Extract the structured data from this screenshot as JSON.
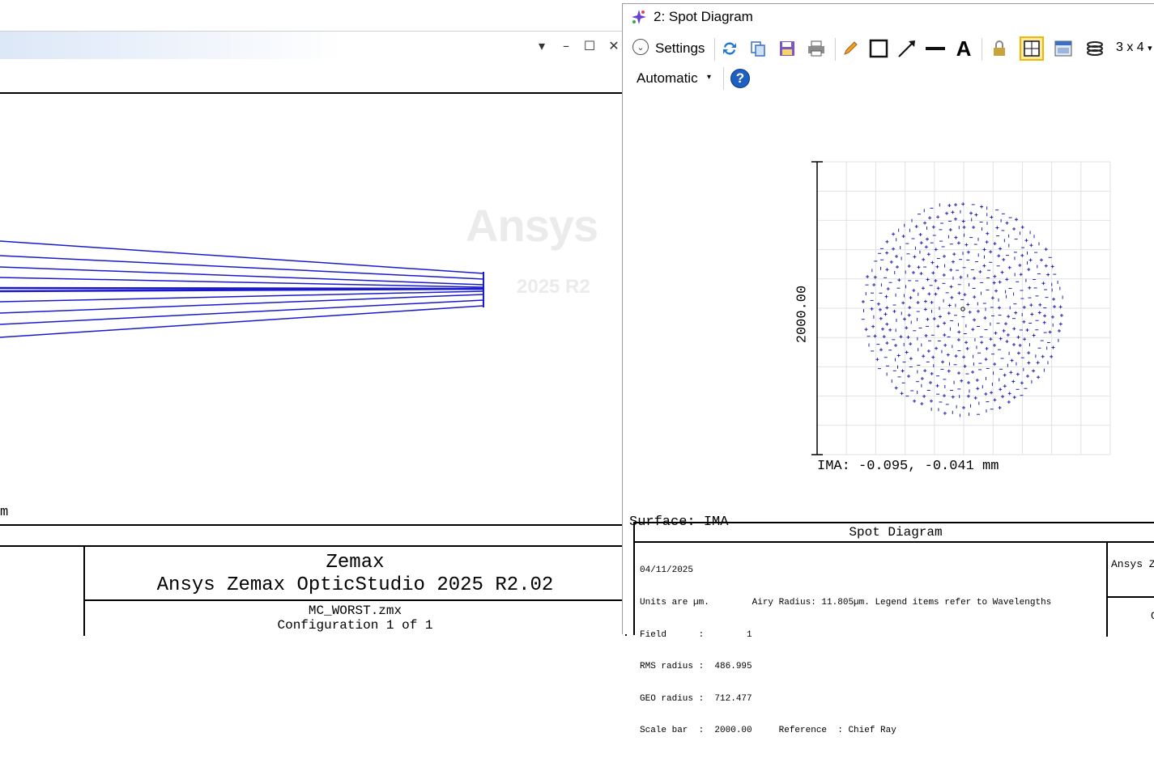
{
  "left_window": {
    "window_controls": {
      "menu": "▾",
      "minimize": "–",
      "maximize": "☐",
      "close": "✕"
    },
    "watermark": {
      "brand": "Ansys",
      "version": "2025 R2"
    },
    "layout_unit_fragment": "m",
    "title_block": {
      "product": "Zemax",
      "full_name": "Ansys Zemax OpticStudio 2025 R2.02",
      "file": "MC_WORST.zmx",
      "configuration": "Configuration 1 of 1"
    }
  },
  "right_window": {
    "title": "2: Spot Diagram",
    "toolbar": {
      "settings_label": "Settings",
      "grid_label": "3 x 4",
      "grid_caret": "▾",
      "automatic_label": "Automatic",
      "automatic_caret": "▾",
      "text_tool_glyph": "A",
      "help_glyph": "?"
    },
    "plot": {
      "scale_bar_label": "2000.00",
      "image_coordinate_label": "IMA: -0.095, -0.041 mm",
      "surface_label": "Surface: IMA"
    },
    "info_block": {
      "heading": "Spot Diagram",
      "lines": [
        "04/11/2025",
        "Units are µm.        Airy Radius: 11.805µm. Legend items refer to Wavelengths",
        "Field      :        1",
        "RMS radius :  486.995",
        "GEO radius :  712.477",
        "Scale bar  :  2000.00     Reference  : Chief Ray"
      ],
      "corner_text": "Ansys Z",
      "corner_text_2": "C"
    }
  },
  "colors": {
    "ray_blue": "#1a1acc",
    "spot_blue": "#2020b0",
    "grid_gray": "#e2e2e2",
    "highlight_yellow": "#f2b600",
    "watermark_gray": "#ebebeb"
  }
}
